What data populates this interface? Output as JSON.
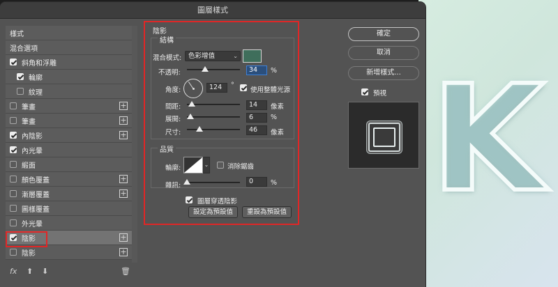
{
  "dialog": {
    "title": "圖層樣式"
  },
  "style_list": [
    {
      "label": "樣式",
      "checkbox": false,
      "checked": false,
      "plus": false,
      "indent": false,
      "selected": false
    },
    {
      "label": "混合選項",
      "checkbox": false,
      "checked": false,
      "plus": false,
      "indent": false,
      "selected": false
    },
    {
      "label": "斜角和浮雕",
      "checkbox": true,
      "checked": true,
      "plus": false,
      "indent": false,
      "selected": false
    },
    {
      "label": "輪廓",
      "checkbox": true,
      "checked": true,
      "plus": false,
      "indent": true,
      "selected": false
    },
    {
      "label": "紋理",
      "checkbox": true,
      "checked": false,
      "plus": false,
      "indent": true,
      "selected": false
    },
    {
      "label": "筆畫",
      "checkbox": true,
      "checked": false,
      "plus": true,
      "indent": false,
      "selected": false
    },
    {
      "label": "筆畫",
      "checkbox": true,
      "checked": false,
      "plus": true,
      "indent": false,
      "selected": false
    },
    {
      "label": "內陰影",
      "checkbox": true,
      "checked": true,
      "plus": true,
      "indent": false,
      "selected": false
    },
    {
      "label": "內光暈",
      "checkbox": true,
      "checked": true,
      "plus": false,
      "indent": false,
      "selected": false
    },
    {
      "label": "緞面",
      "checkbox": true,
      "checked": false,
      "plus": false,
      "indent": false,
      "selected": false
    },
    {
      "label": "顏色覆蓋",
      "checkbox": true,
      "checked": false,
      "plus": true,
      "indent": false,
      "selected": false
    },
    {
      "label": "漸層覆蓋",
      "checkbox": true,
      "checked": false,
      "plus": true,
      "indent": false,
      "selected": false
    },
    {
      "label": "圖樣覆蓋",
      "checkbox": true,
      "checked": false,
      "plus": false,
      "indent": false,
      "selected": false
    },
    {
      "label": "外光暈",
      "checkbox": true,
      "checked": false,
      "plus": false,
      "indent": false,
      "selected": false
    },
    {
      "label": "陰影",
      "checkbox": true,
      "checked": true,
      "plus": true,
      "indent": false,
      "selected": true
    },
    {
      "label": "陰影",
      "checkbox": true,
      "checked": false,
      "plus": true,
      "indent": false,
      "selected": false
    }
  ],
  "bottom_icons": {
    "fx": "fx",
    "up": "⬆",
    "down": "⬇",
    "trash": "🗑"
  },
  "drop_shadow": {
    "section_title": "陰影",
    "structure": {
      "title": "結構",
      "blend_mode_label": "混合模式:",
      "blend_mode_value": "色彩增值",
      "color": "#3f6e5b",
      "opacity_label": "不透明:",
      "opacity_value": "34",
      "opacity_unit": "%",
      "opacity_fraction": 0.34,
      "angle_label": "角度:",
      "angle_value": "124",
      "angle_unit": "°",
      "global_light_label": "使用整體光源",
      "global_light_checked": true,
      "distance_label": "間距:",
      "distance_value": "14",
      "distance_unit": "像素",
      "spread_label": "展開:",
      "spread_value": "6",
      "spread_unit": "%",
      "size_label": "尺寸:",
      "size_value": "46",
      "size_unit": "像素"
    },
    "quality": {
      "title": "品質",
      "contour_label": "輪廓:",
      "anti_alias_label": "消除鋸齒",
      "anti_alias_checked": false,
      "noise_label": "雜訊:",
      "noise_value": "0",
      "noise_unit": "%"
    },
    "knockout_label": "圖層穿透陰影",
    "knockout_checked": true,
    "make_default_label": "設定為預設值",
    "reset_default_label": "重設為預設值"
  },
  "right_panel": {
    "ok_label": "確定",
    "cancel_label": "取消",
    "new_style_label": "新增樣式...",
    "preview_label": "預視",
    "preview_checked": true
  },
  "canvas": {
    "letter": "K"
  },
  "colors": {
    "highlight": "#e12626",
    "dialog_bg": "#535353"
  }
}
